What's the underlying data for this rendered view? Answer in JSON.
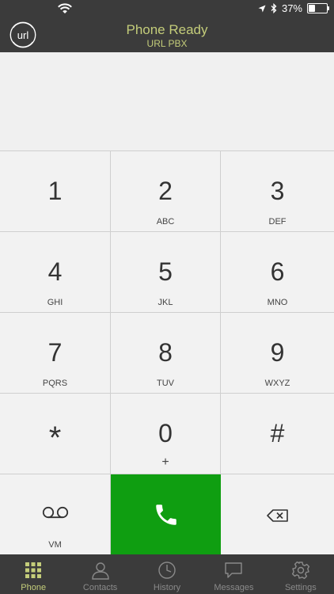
{
  "status_bar": {
    "battery": "37%",
    "battery_level": 0.37
  },
  "header": {
    "title": "Phone Ready",
    "subtitle": "URL PBX",
    "logo_text": "url",
    "accent": "#c4cd7a",
    "background": "#3b3b3b"
  },
  "keypad": {
    "keys": [
      {
        "digit": "1",
        "letters": ""
      },
      {
        "digit": "2",
        "letters": "ABC"
      },
      {
        "digit": "3",
        "letters": "DEF"
      },
      {
        "digit": "4",
        "letters": "GHI"
      },
      {
        "digit": "5",
        "letters": "JKL"
      },
      {
        "digit": "6",
        "letters": "MNO"
      },
      {
        "digit": "7",
        "letters": "PQRS"
      },
      {
        "digit": "8",
        "letters": "TUV"
      },
      {
        "digit": "9",
        "letters": "WXYZ"
      },
      {
        "digit": "*",
        "letters": ""
      },
      {
        "digit": "0",
        "letters": "+"
      },
      {
        "digit": "#",
        "letters": ""
      }
    ],
    "voicemail_label": "VM",
    "call_color": "#0f9e11"
  },
  "tabs": [
    {
      "label": "Phone",
      "icon": "keypad-icon",
      "active": true
    },
    {
      "label": "Contacts",
      "icon": "person-icon"
    },
    {
      "label": "History",
      "icon": "clock-icon"
    },
    {
      "label": "Messages",
      "icon": "chat-bubble-icon"
    },
    {
      "label": "Settings",
      "icon": "gear-icon"
    }
  ]
}
